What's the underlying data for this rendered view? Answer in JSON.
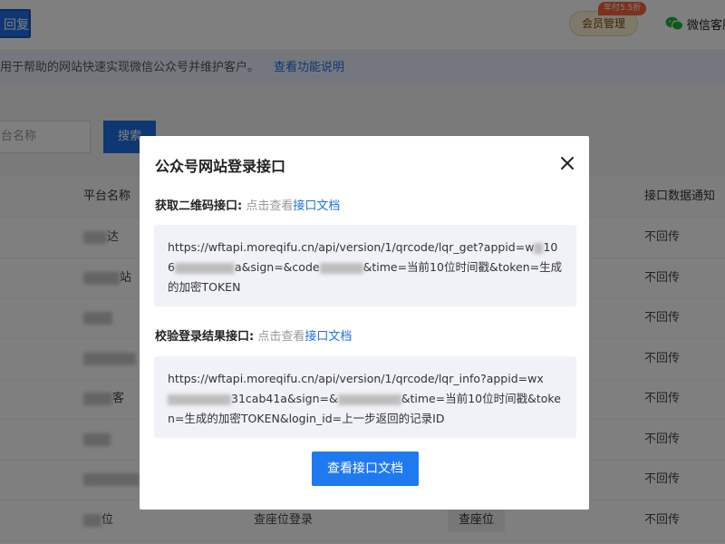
{
  "topbar": {
    "reply_button": "回复",
    "vip_badge": "年付5.5折",
    "vip_button": "会员管理",
    "wechat_label": "微信客服"
  },
  "info_bar": {
    "text": "用于帮助的网站快速实现微信公众号并维护客户。",
    "link": "查看功能说明"
  },
  "search": {
    "placeholder": "台名称",
    "button": "搜索"
  },
  "table": {
    "columns": [
      "平台名称",
      "接口数据通知"
    ],
    "rows": [
      {
        "name_visible": "达",
        "notify": "不回传"
      },
      {
        "name_visible": "站",
        "notify": "不回传"
      },
      {
        "name_visible": "",
        "notify": "不回传"
      },
      {
        "name_visible": "",
        "notify": "不回传"
      },
      {
        "name_visible": "客",
        "notify": "不回传"
      },
      {
        "name_visible": "",
        "notify": "不回传"
      },
      {
        "name_visible": "",
        "notify": "不回传"
      },
      {
        "name_visible": "位",
        "interface": "查座位登录",
        "tag": "查座位",
        "notify": "不回传"
      }
    ]
  },
  "modal": {
    "title": "公众号网站登录接口",
    "qrcode_section": {
      "label": "获取二维码接口:",
      "hint": "点击查看",
      "doc_link": "接口文档",
      "url_part1": "https://wftapi.moreqifu.cn/api/version/1/qrcode/lqr_get?appid=w",
      "url_part2": "106",
      "url_part3": "a&sign=&code",
      "url_part4": "&time=当前10位时间戳&token=生成的加密TOKEN"
    },
    "verify_section": {
      "label": "校验登录结果接口:",
      "hint": "点击查看",
      "doc_link": "接口文档",
      "url_part1": "https://wftapi.moreqifu.cn/api/version/1/qrcode/lqr_info?appid=w",
      "url_part2": "x",
      "url_part3": "31cab41a&sign=&",
      "url_part4": "&time=当前10位时间戳&token=生成的加密TOKEN&login_id=上一步返回的记录ID"
    },
    "primary_button": "查看接口文档"
  }
}
